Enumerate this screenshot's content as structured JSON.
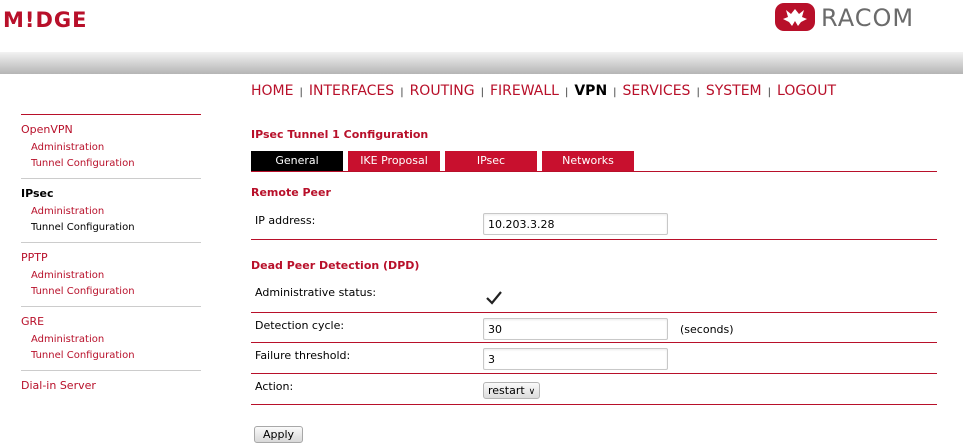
{
  "brand": {
    "left_logo": "M!DGE",
    "right_logo": "RACOM"
  },
  "nav": {
    "items": [
      "HOME",
      "INTERFACES",
      "ROUTING",
      "FIREWALL",
      "VPN",
      "SERVICES",
      "SYSTEM",
      "LOGOUT"
    ],
    "active": "VPN",
    "separator": "|"
  },
  "sidebar": {
    "groups": [
      {
        "title": "OpenVPN",
        "items": [
          "Administration",
          "Tunnel Configuration"
        ]
      },
      {
        "title": "IPsec",
        "items": [
          "Administration",
          "Tunnel Configuration"
        ]
      },
      {
        "title": "PPTP",
        "items": [
          "Administration",
          "Tunnel Configuration"
        ]
      },
      {
        "title": "GRE",
        "items": [
          "Administration",
          "Tunnel Configuration"
        ]
      },
      {
        "title": "Dial-in Server",
        "items": []
      }
    ]
  },
  "page": {
    "title": "IPsec Tunnel 1 Configuration",
    "tabs": [
      "General",
      "IKE Proposal",
      "IPsec",
      "Networks"
    ],
    "active_tab": "General"
  },
  "remote_peer": {
    "section_title": "Remote Peer",
    "ip_label": "IP address:",
    "ip_value": "10.203.3.28"
  },
  "dpd": {
    "section_title": "Dead Peer Detection (DPD)",
    "admin_status_label": "Administrative status:",
    "admin_status_checked": true,
    "detection_cycle_label": "Detection cycle:",
    "detection_cycle_value": "30",
    "detection_cycle_units": "(seconds)",
    "failure_threshold_label": "Failure threshold:",
    "failure_threshold_value": "3",
    "action_label": "Action:",
    "action_value": "restart"
  },
  "apply_label": "Apply",
  "colors": {
    "accent": "#b8102a",
    "tab_bg": "#c8102e",
    "tab_active_bg": "#000000"
  }
}
